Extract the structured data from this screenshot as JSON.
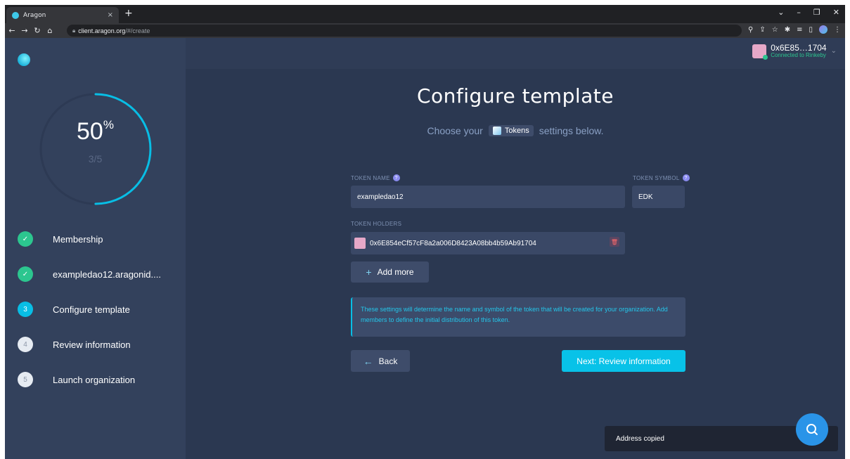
{
  "browser": {
    "tab_title": "Aragon",
    "tab_close": "×",
    "new_tab": "+",
    "url_host": "client.aragon.org",
    "url_path": "/#/create",
    "window_controls": [
      "⌄",
      "–",
      "❐",
      "✕"
    ]
  },
  "account": {
    "address": "0x6E85…1704",
    "network": "Connected to Rinkeby"
  },
  "progress": {
    "percent": "50",
    "percent_symbol": "%",
    "fraction": "3/5",
    "value": 0.5
  },
  "steps": [
    {
      "label": "Membership",
      "badge": "✓",
      "state": "done"
    },
    {
      "label": "exampledao12.aragonid....",
      "badge": "✓",
      "state": "done"
    },
    {
      "label": "Configure template",
      "badge": "3",
      "state": "active"
    },
    {
      "label": "Review information",
      "badge": "4",
      "state": "todo"
    },
    {
      "label": "Launch organization",
      "badge": "5",
      "state": "todo"
    }
  ],
  "main": {
    "title": "Configure template",
    "subtitle_prefix": "Choose your",
    "subtitle_badge": "Tokens",
    "subtitle_suffix": "settings below.",
    "token_name_label": "TOKEN NAME",
    "token_name_value": "exampledao12",
    "token_symbol_label": "TOKEN SYMBOL",
    "token_symbol_value": "EDK",
    "token_holders_label": "TOKEN HOLDERS",
    "token_holder_address": "0x6E854eCf57cF8a2a006D8423A08bb4b59Ab91704",
    "add_more_label": "Add more",
    "info_text": "These settings will determine the name and symbol of the token that will be created for your organization. Add members to define the initial distribution of this token.",
    "back_label": "Back",
    "next_label": "Next: Review information"
  },
  "toast": {
    "text": "Address copied"
  },
  "colors": {
    "accent": "#08c2e8",
    "done": "#2cc68f",
    "sidebar": "#33415c",
    "background": "#2b3851"
  }
}
